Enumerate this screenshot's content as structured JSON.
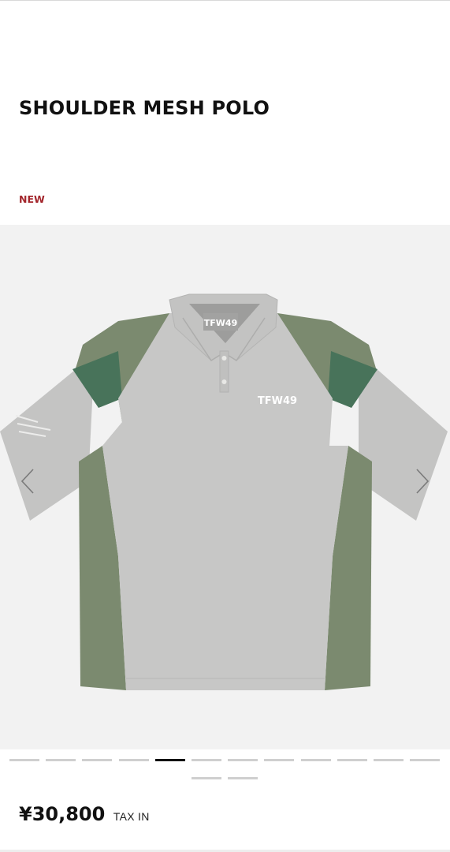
{
  "product": {
    "title": "SHOULDER MESH POLO",
    "badge": "NEW",
    "price": "¥30,800",
    "tax_label": "TAX IN"
  },
  "gallery": {
    "image_label": "TFW49",
    "slide_count": 14,
    "active_slide": 5,
    "prev_icon": "chevron-left-icon",
    "next_icon": "chevron-right-icon"
  },
  "colors": {
    "badge": "#a3262c",
    "gallery_background": "#f2f2f2",
    "body_gray": "#c6c6c5",
    "olive_panel": "#7a8a6e",
    "green_band": "#48735a",
    "dot_inactive": "#cfcfcf",
    "dot_active": "#111111"
  }
}
